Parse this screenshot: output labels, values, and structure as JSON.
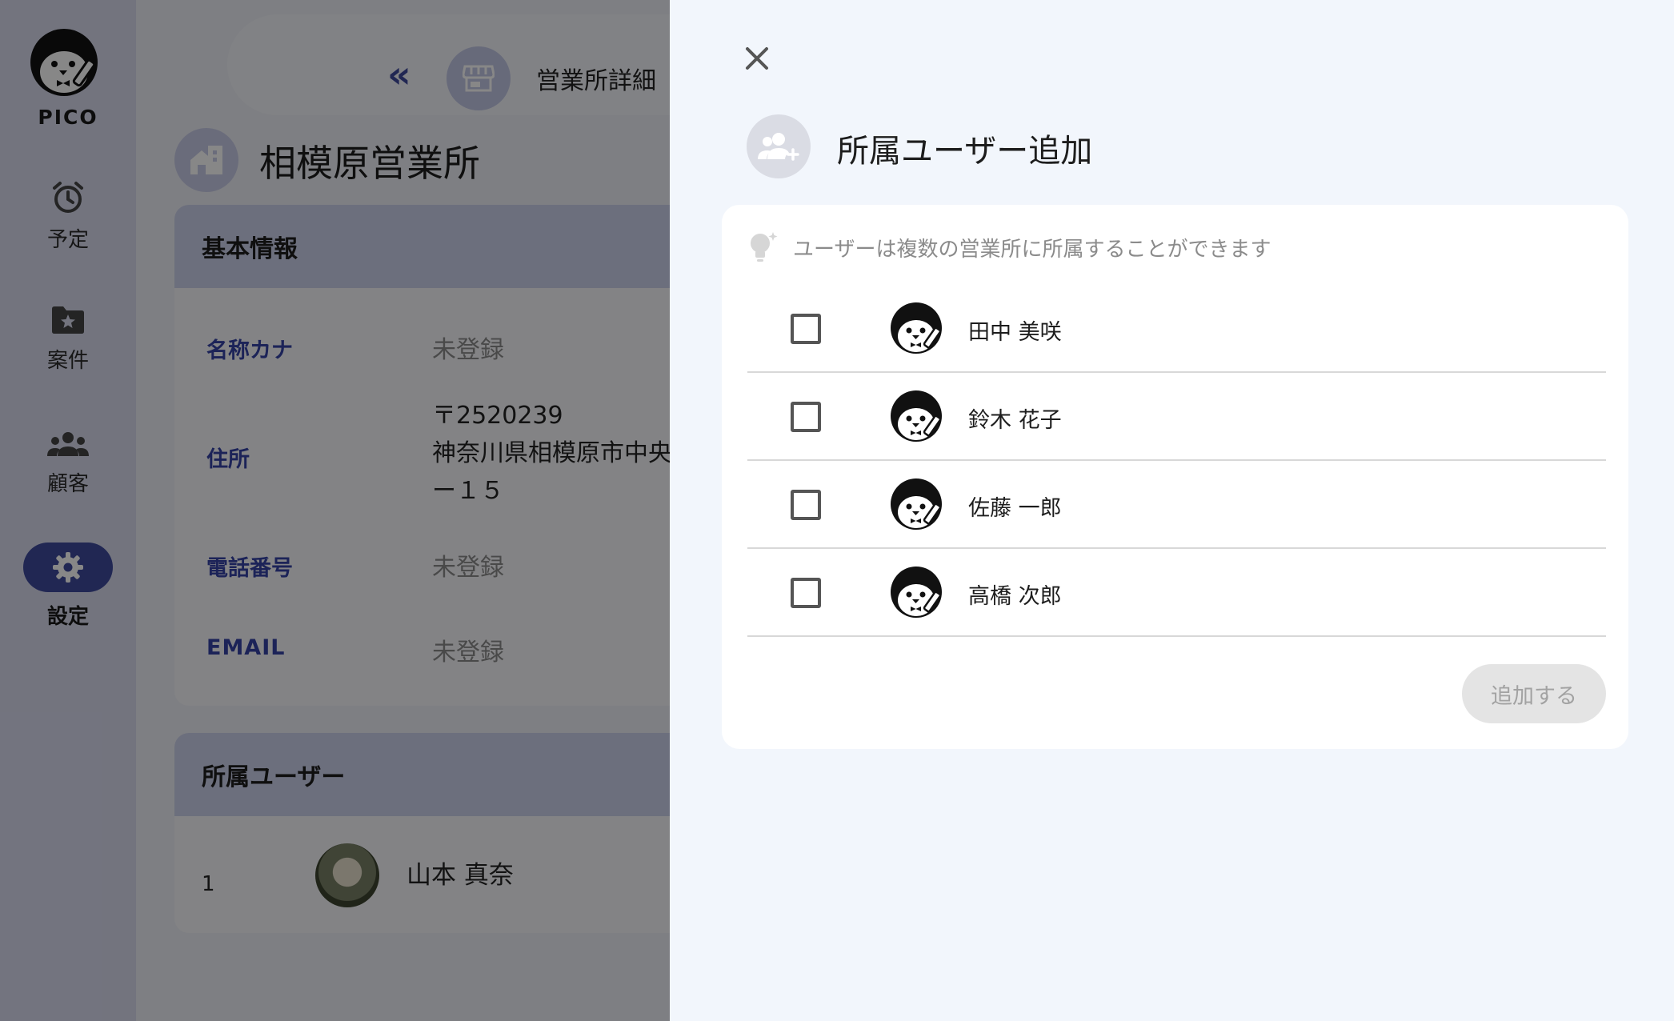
{
  "sidebar": {
    "brand": "PICO",
    "items": [
      {
        "label": "予定",
        "icon": "alarm-clock-icon"
      },
      {
        "label": "案件",
        "icon": "folder-star-icon"
      },
      {
        "label": "顧客",
        "icon": "people-icon"
      },
      {
        "label": "設定",
        "icon": "gear-icon",
        "active": true
      }
    ]
  },
  "header": {
    "title": "営業所詳細",
    "back_icon": "double-chevron-left-icon",
    "store_icon": "storefront-icon"
  },
  "office": {
    "name": "相模原営業所",
    "icon": "office-building-icon"
  },
  "basic_info": {
    "title": "基本情報",
    "fields": [
      {
        "label": "名称カナ",
        "value": "未登録"
      },
      {
        "label": "住所",
        "value_lines": [
          "〒2520239",
          "神奈川県相模原市中央",
          "ー１５"
        ]
      },
      {
        "label": "電話番号",
        "value": "未登録"
      },
      {
        "label": "EMAIL",
        "value": "未登録"
      }
    ]
  },
  "members": {
    "title": "所属ユーザー",
    "rows": [
      {
        "number": "1",
        "name": "山本 真奈"
      }
    ]
  },
  "drawer": {
    "title": "所属ユーザー追加",
    "title_icon": "add-user-icon",
    "close_icon": "close-icon",
    "hint": "ユーザーは複数の営業所に所属することができます",
    "hint_icon": "lightbulb-icon",
    "users": [
      {
        "name": "田中 美咲",
        "checked": false
      },
      {
        "name": "鈴木 花子",
        "checked": false
      },
      {
        "name": "佐藤 一郎",
        "checked": false
      },
      {
        "name": "高橋 次郎",
        "checked": false
      }
    ],
    "submit_label": "追加する"
  },
  "colors": {
    "accent": "#3f4a9e",
    "label_blue": "#3543a6",
    "drawer_bg": "#f2f6fc",
    "disabled_button": "#e4e4e4"
  }
}
